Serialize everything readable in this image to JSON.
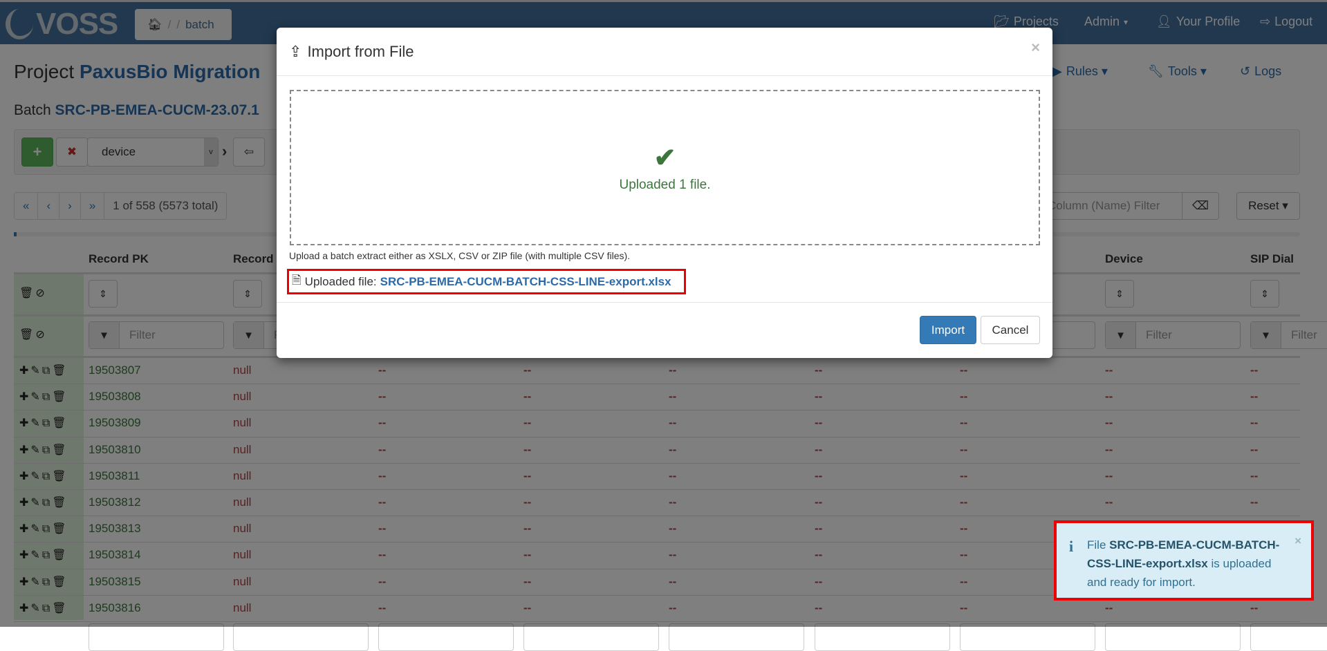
{
  "navbar": {
    "logo": "VOSS",
    "breadcrumb": {
      "home_icon": "home-icon",
      "sep1": "/",
      "sep2": "/",
      "current": "batch"
    },
    "items": [
      {
        "icon": "folder-open-icon",
        "label": "Projects"
      },
      {
        "label": "Admin",
        "caret": "▾"
      },
      {
        "icon": "user-icon",
        "label": "Your Profile"
      },
      {
        "icon": "logout-icon",
        "label": "Logout"
      }
    ]
  },
  "page": {
    "project_prefix": "Project",
    "project_name": "PaxusBio Migration",
    "batch_prefix": "Batch",
    "batch_name": "SRC-PB-EMEA-CUCM-23.07.1",
    "subnav": [
      {
        "icon": "play-circle-icon",
        "label": "Rules ▾"
      },
      {
        "icon": "wrench-icon",
        "label": "Tools ▾"
      },
      {
        "icon": "history-icon",
        "label": "Logs"
      }
    ]
  },
  "toolbar": {
    "add": "+",
    "remove": "✖",
    "entity_select": "device",
    "chevron": "›",
    "import_icon": "⇦"
  },
  "pager": {
    "first": "«",
    "prev": "‹",
    "next": "›",
    "last": "»",
    "status": "1 of 558 (5573 total)"
  },
  "column_filter": {
    "placeholder": "Column (Name) Filter"
  },
  "reset_label": "Reset ▾",
  "progress_percent": 0.2,
  "table": {
    "headers": [
      "Record PK",
      "Record",
      "",
      "",
      "",
      "",
      "",
      "Device",
      "SIP Dial"
    ],
    "filter_placeholder": "Filter",
    "rows": [
      {
        "pk": "19503807",
        "rec": "null"
      },
      {
        "pk": "19503808",
        "rec": "null"
      },
      {
        "pk": "19503809",
        "rec": "null"
      },
      {
        "pk": "19503810",
        "rec": "null"
      },
      {
        "pk": "19503811",
        "rec": "null"
      },
      {
        "pk": "19503812",
        "rec": "null"
      },
      {
        "pk": "19503813",
        "rec": "null"
      },
      {
        "pk": "19503814",
        "rec": "null"
      },
      {
        "pk": "19503815",
        "rec": "null"
      },
      {
        "pk": "19503816",
        "rec": "null"
      }
    ],
    "empty_cell": "--"
  },
  "modal": {
    "title": "Import from File",
    "close": "×",
    "status": "Uploaded 1 file.",
    "help": "Upload a batch extract either as XSLX, CSV or ZIP file (with multiple CSV files).",
    "uploaded_label": "Uploaded file:",
    "uploaded_file": "SRC-PB-EMEA-CUCM-BATCH-CSS-LINE-export.xlsx",
    "import": "Import",
    "cancel": "Cancel"
  },
  "toast": {
    "prefix": "File",
    "file": "SRC-PB-EMEA-CUCM-BATCH-CSS-LINE-export.xlsx",
    "suffix": "is uploaded and ready for import.",
    "close": "×",
    "type": "info"
  },
  "colors": {
    "navbar": "#42709e",
    "primary": "#337ab7",
    "success": "#3c763d",
    "danger": "#a94442",
    "info_bg": "#d9edf7",
    "highlight": "#ee0000"
  }
}
